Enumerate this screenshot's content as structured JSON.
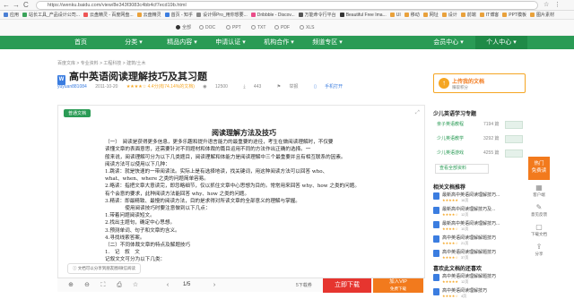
{
  "browser": {
    "url": "https://wenku.baidu.com/view/8e343f3083c4bb4cf7ecd19b.html",
    "nav_back": "←",
    "nav_forward": "→",
    "nav_reload": "C"
  },
  "bookmarks": [
    {
      "label": "应用",
      "color": "#4a7fd4"
    },
    {
      "label": "站长工具_产品设计公司...",
      "color": "#3aa35a"
    },
    {
      "label": "云盘精灵 - 百度网盘...",
      "color": "#e55"
    },
    {
      "label": "云盘精灵",
      "color": "#e9a13b"
    },
    {
      "label": "首页 - 知乎",
      "color": "#3b7de0"
    },
    {
      "label": "设计师Pro_用你想要...",
      "color": "#888"
    },
    {
      "label": "Dribbble - Discov...",
      "color": "#ea4c89"
    },
    {
      "label": "万能命令行平台",
      "color": "#555"
    },
    {
      "label": "Beautiful Free Ima...",
      "color": "#333"
    },
    {
      "label": "UI",
      "color": "#e9a13b"
    },
    {
      "label": "移动",
      "color": "#e9a13b"
    },
    {
      "label": "网址",
      "color": "#e9a13b"
    },
    {
      "label": "设计",
      "color": "#e9a13b"
    },
    {
      "label": "前端",
      "color": "#e9a13b"
    },
    {
      "label": "IT博客",
      "color": "#e9a13b"
    },
    {
      "label": "PPT模板",
      "color": "#e9a13b"
    },
    {
      "label": "图片素材",
      "color": "#e9a13b"
    }
  ],
  "search_types": [
    {
      "label": "全部",
      "on": true
    },
    {
      "label": "DOC",
      "on": false
    },
    {
      "label": "PPT",
      "on": false
    },
    {
      "label": "TXT",
      "on": false
    },
    {
      "label": "PDF",
      "on": false
    },
    {
      "label": "XLS",
      "on": false
    }
  ],
  "nav": {
    "items": [
      "首页",
      "分类",
      "精品内容",
      "申请认证",
      "机构合作",
      "频道专区"
    ],
    "right_items": [
      "会员中心",
      "个人中心"
    ]
  },
  "breadcrumb": "百度文库 > 专业资料 > 工程科技 > 建筑/土木",
  "doc": {
    "type_icon": "W",
    "title": "高中英语阅读理解技巧及其习题",
    "author": "yuyuan881084",
    "date": "2011-10-20",
    "rating": "★★★★☆ 4.4分(有74.14%的文档)",
    "views": "12500",
    "downloads": "443",
    "share": "举报",
    "mobile": "手机打开",
    "badge": "普通文档",
    "tip": "文档可以分享到朋友圈/微信阅读"
  },
  "paper": {
    "heading": "阅读理解方法及技巧",
    "lines": [
      "（一）　阅读是获得更多信息，更多乐趣和提升语言能力的最重要的途径，考生在做阅读理解时，不仅要",
      "读懂文章的表面意思，还需要针对不同题材和体裁的篇目运用不同的方法作出正确的选择。一",
      "般来说，阅读理解可分为以下几类题目，阅读理解和体能力是阅读理解中三个最重要并且有相互联系的因素。",
      "阅读方法可以使用以下几种：",
      "1.跳读：就是快速的一带阅读法。实际上是有选择地读，找关键词，用这种阅读方法可以回答 who、",
      "what、when、where 之类的问题简单容易。",
      "2.略读：指把文章大意读完，即忽略细节，仅以抓住文章中心思想为目的。常常用来回答 why、how 之类的问题。",
      "有个会意的要求，此种阅读方法能回答 why、how 之类的问题。",
      "3.精读：即最精致、最慢的阅读方法，目的是求得对所读文章的全部意义的理解与掌握。",
      "　　　　使用阅读技巧时要注意做到以下几点：",
      "1.带着问题阅读短文。",
      "2.找出主题句，确定中心思想。",
      "3.预测单词、句子和文章的含义。",
      "4.寻找线索答案。",
      "（二）不同体裁文章的特点及解题技巧",
      "1.　记　叙　文",
      "记叙文文可分为以下几类："
    ]
  },
  "toolbar": {
    "page": "1",
    "page_total": "/5",
    "down_label": "下载券",
    "down_count": "5",
    "download_btn": "立即下载",
    "vip_btn": "加入VIP",
    "vip_sub": "免费下载"
  },
  "right": {
    "upload_title": "上传我的文档",
    "upload_sub": "赚取积分",
    "section1": "少儿英语学习专题",
    "collections": [
      {
        "name": "亲子英语教程",
        "count": "7194 篇"
      },
      {
        "name": "少儿英语教学",
        "count": "3292 篇"
      },
      {
        "name": "少儿英语游戏",
        "count": "4255 篇"
      }
    ],
    "view_all": "查看全部资料",
    "section2": "相关文档推荐",
    "related": [
      {
        "name": "最新高中英语阅读理解技巧...",
        "stars": "★★★★★",
        "pages": "16页"
      },
      {
        "name": "最新高中阅读理解技巧及...",
        "stars": "★★★★☆",
        "pages": "12页"
      },
      {
        "name": "最新高中英语阅读理解技巧...",
        "stars": "★★★★☆",
        "pages": "10页"
      },
      {
        "name": "高中英语阅读理解解题技巧",
        "stars": "★★★★☆",
        "pages": "21页"
      },
      {
        "name": "高中英语阅读理解解题技巧",
        "stars": "★★★★☆",
        "pages": "37页"
      }
    ],
    "section3": "喜欢此文档的还喜欢",
    "liked": [
      {
        "name": "高中英语阅读理解解题技巧",
        "stars": "★★★★★",
        "pages": "12页"
      },
      {
        "name": "高中英语阅读理解技巧",
        "stars": "★★★★☆",
        "pages": "4页"
      }
    ]
  },
  "floatbar": {
    "hot": "热门\n免费读",
    "items": [
      "客户端",
      "意见反馈",
      "下载文档",
      "分享"
    ]
  },
  "colors": {
    "green": "#2a9b55",
    "orange": "#f5a623",
    "red": "#e6352f",
    "blue": "#3b7de0"
  }
}
